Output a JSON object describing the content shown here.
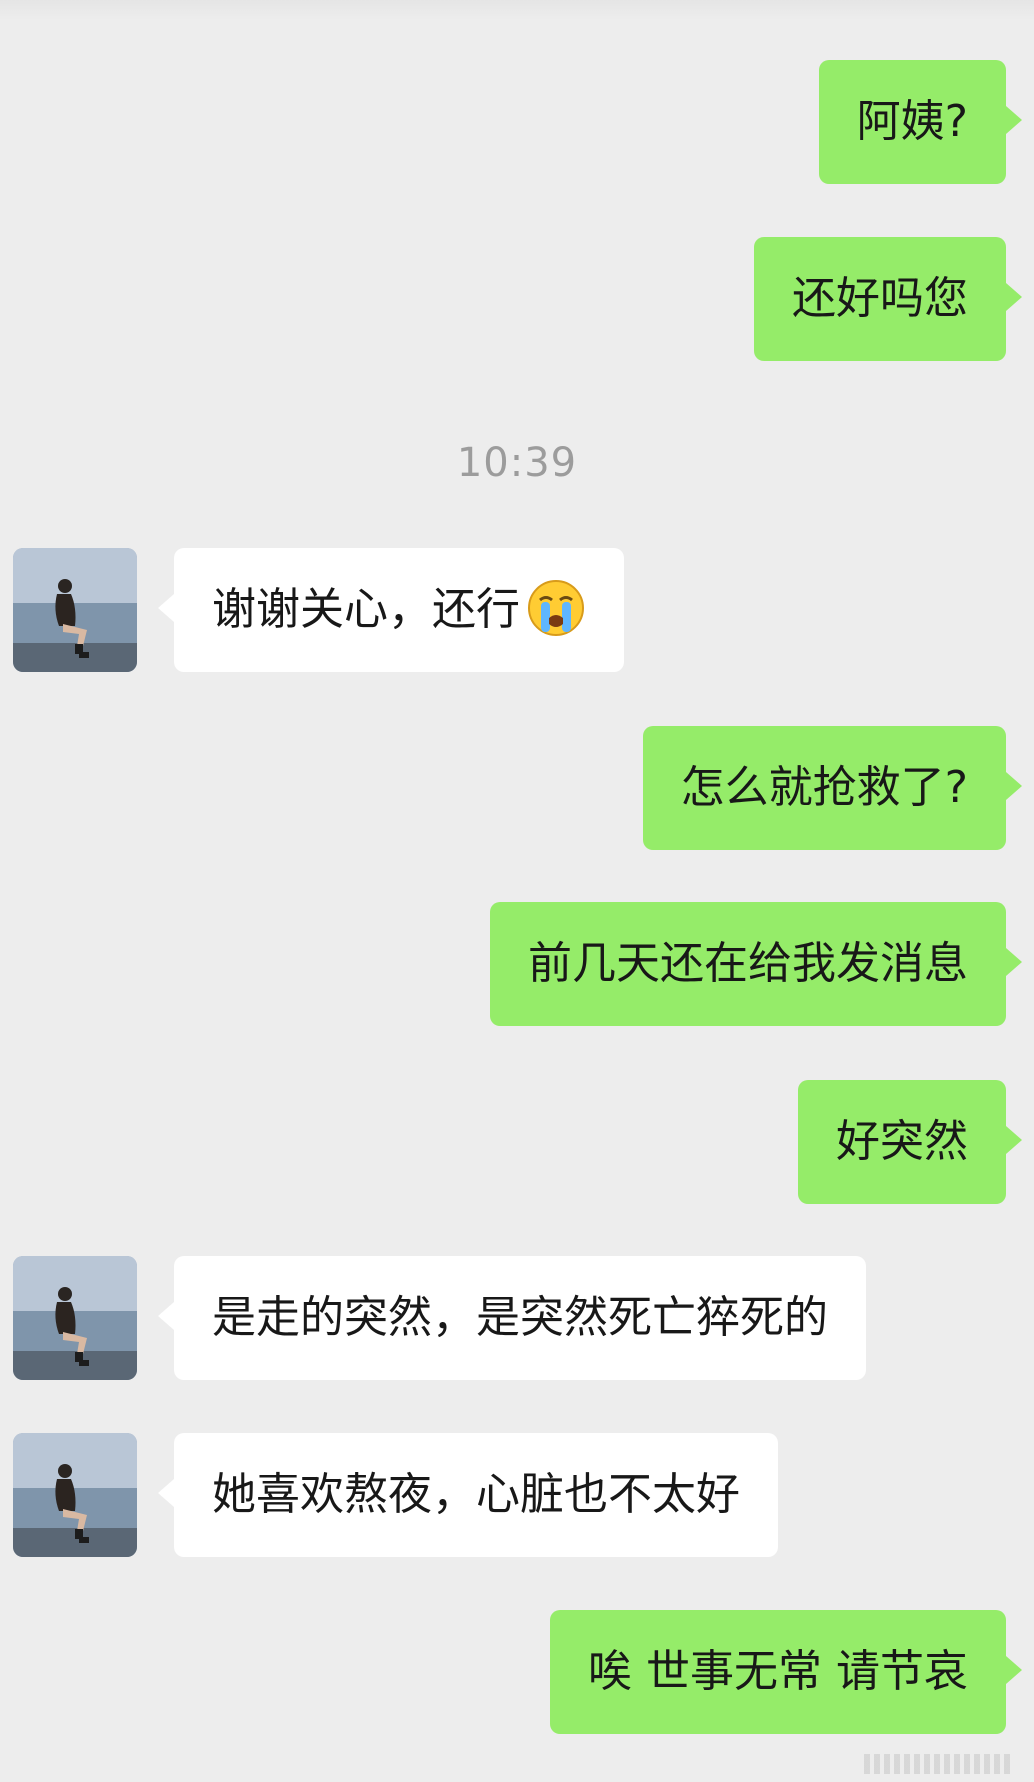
{
  "timestamp": "10:39",
  "messages": [
    {
      "side": "out",
      "text": "阿姨?"
    },
    {
      "side": "out",
      "text": "还好吗您"
    },
    {
      "side": "in",
      "text": "谢谢关心，还行",
      "emoji": "loudly-crying-face-icon"
    },
    {
      "side": "out",
      "text": "怎么就抢救了?"
    },
    {
      "side": "out",
      "text": "前几天还在给我发消息"
    },
    {
      "side": "out",
      "text": "好突然"
    },
    {
      "side": "in",
      "text": "是走的突然，是突然死亡猝死的"
    },
    {
      "side": "in",
      "text": "她喜欢熬夜，心脏也不太好"
    },
    {
      "side": "out",
      "text": "唉 世事无常 请节哀"
    }
  ],
  "colors": {
    "background": "#ededed",
    "outgoing_bubble": "#95ec69",
    "incoming_bubble": "#ffffff",
    "timestamp_text": "#9c9c9c"
  }
}
